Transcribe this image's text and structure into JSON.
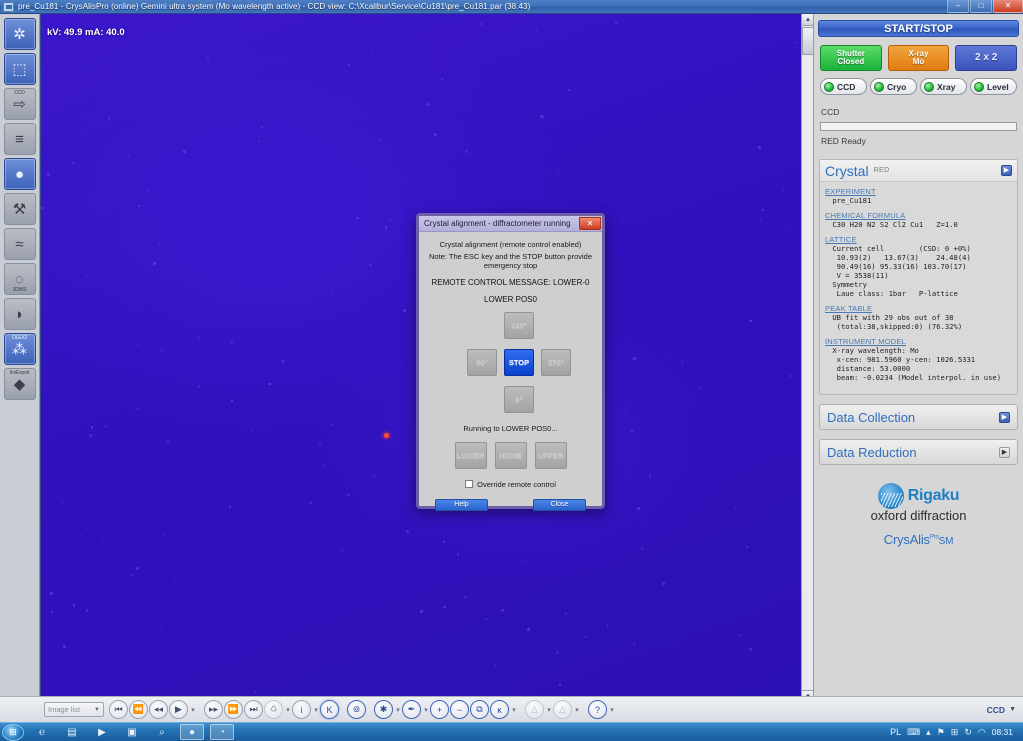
{
  "window": {
    "title": "pre_Cu181 - CrysAlisPro (online) Gemini ultra system (Mo wavelength active) - CCD view: C:\\Xcalibur\\Service\\Cu181\\pre_Cu181.par  (38.43)",
    "minimize_label": "–",
    "maximize_label": "□",
    "close_label": "✕"
  },
  "left_tools": [
    {
      "name": "crystal-screening-tool",
      "glyph": "✲",
      "top_label": "",
      "bottom_label": "",
      "selected": true
    },
    {
      "name": "data-collection-tool",
      "glyph": "⬚",
      "top_label": "",
      "bottom_label": "",
      "selected": true
    },
    {
      "name": "data-reduction-tool",
      "glyph": "⇨",
      "top_label": "CCD",
      "bottom_label": "",
      "selected": false
    },
    {
      "name": "frames-tool",
      "glyph": "≡",
      "top_label": "",
      "bottom_label": "",
      "selected": false
    },
    {
      "name": "ccd-view-tool",
      "glyph": "●",
      "top_label": "",
      "bottom_label": "",
      "selected": true
    },
    {
      "name": "instrument-tool",
      "glyph": "⚒",
      "top_label": "",
      "bottom_label": "",
      "selected": false
    },
    {
      "name": "diffraction-pattern-tool",
      "glyph": "≈",
      "top_label": "",
      "bottom_label": "",
      "selected": false
    },
    {
      "name": "reciprocal-space-tool",
      "glyph": "◌",
      "top_label": "",
      "bottom_label": "3DWS",
      "selected": false
    },
    {
      "name": "camera-tool",
      "glyph": "◗",
      "top_label": "",
      "bottom_label": "",
      "selected": false
    },
    {
      "name": "olex2-tool",
      "glyph": "⁂",
      "top_label": "OLEX2",
      "bottom_label": "",
      "selected": true
    },
    {
      "name": "import-export-tool",
      "glyph": "◆",
      "top_label": "Im/Export",
      "bottom_label": "",
      "selected": false
    }
  ],
  "image_view": {
    "kv_readout": "kV: 49.9 mA: 40.0",
    "scroll_up": "▲",
    "scroll_down": "▼"
  },
  "right_panel": {
    "start_stop_label": "START/STOP",
    "buttons": [
      {
        "name": "shutter-button",
        "line1": "Shutter",
        "line2": "Closed",
        "color": "#19b23a"
      },
      {
        "name": "xray-button",
        "line1": "X-ray",
        "line2": "Mo",
        "color": "#e07c12"
      },
      {
        "name": "binning-button",
        "line1": "2 x 2",
        "line2": "",
        "color": "#3a53bb"
      }
    ],
    "leds": [
      {
        "name": "ccd-led",
        "label": "CCD"
      },
      {
        "name": "cryo-led",
        "label": "Cryo"
      },
      {
        "name": "xray-led",
        "label": "Xray"
      },
      {
        "name": "level-led",
        "label": "Level"
      }
    ],
    "ccd_label": "CCD",
    "progress_percent": 0,
    "status_text": "RED  Ready",
    "crystal": {
      "title": "Crystal",
      "subtitle": "RED",
      "groups": [
        {
          "title": "EXPERIMENT",
          "lines": [
            " pre_Cu181"
          ]
        },
        {
          "title": "CHEMICAL FORMULA",
          "lines": [
            " C30 H20 N2 S2 Cl2 Cu1   Z=1.0"
          ]
        },
        {
          "title": "LATTICE",
          "lines": [
            " Current cell        (CSD: 0 +0%)",
            "  10.93(2)   13.67(3)    24.48(4)",
            "  90.49(16) 95.33(16) 103.70(17)",
            "  V = 3538(11)",
            " Symmetry",
            "  Laue class: 1bar   P-lattice"
          ]
        },
        {
          "title": "PEAK TABLE",
          "lines": [
            " UB fit with 29 obs out of 38",
            "  (total:38,skipped:0) (76.32%)"
          ]
        },
        {
          "title": "INSTRUMENT MODEL",
          "lines": [
            " X-ray wavelength: Mo",
            "  x-cen: 981.5960 y-cen: 1026.5331",
            "  distance: 53.0000",
            "  beam: -0.0234 (Model interpol. in use)"
          ]
        }
      ]
    },
    "data_collection_label": "Data Collection",
    "data_reduction_label": "Data Reduction",
    "brand_name": "Rigaku",
    "brand_sub": "oxford diffraction",
    "product_name": "CrysAlis",
    "product_suffix": "SM",
    "product_tm": "Pro"
  },
  "bottom_bar": {
    "image_list_label": "Image list",
    "nav_buttons": [
      {
        "name": "first-image-button",
        "glyph": "⏮"
      },
      {
        "name": "prev-block-button",
        "glyph": "⏪"
      },
      {
        "name": "prev-image-button",
        "glyph": "◂◂"
      },
      {
        "name": "play-button",
        "glyph": "▶"
      },
      {
        "name": "next-image-button",
        "glyph": "▸▸"
      },
      {
        "name": "next-block-button",
        "glyph": "⏩"
      },
      {
        "name": "last-image-button",
        "glyph": "⏭"
      },
      {
        "name": "loop-button",
        "glyph": "♻"
      },
      {
        "name": "info-button",
        "glyph": "i"
      },
      {
        "name": "k-button",
        "glyph": "K"
      },
      {
        "name": "mask-button",
        "glyph": "⊚"
      },
      {
        "name": "brightness-button",
        "glyph": "✱"
      },
      {
        "name": "pointer-button",
        "glyph": "✒"
      },
      {
        "name": "zoom-in-button",
        "glyph": "+"
      },
      {
        "name": "zoom-out-button",
        "glyph": "−"
      },
      {
        "name": "zoom-fit-button",
        "glyph": "⧉"
      },
      {
        "name": "peak-hunt-button",
        "glyph": "ĸ"
      },
      {
        "name": "up-arrow-button",
        "glyph": "△"
      },
      {
        "name": "up-arrow2-button",
        "glyph": "△"
      },
      {
        "name": "help-button",
        "glyph": "?"
      }
    ],
    "detector_label": "CCD",
    "dropdown_caret": "▼"
  },
  "taskbar": {
    "start_glyph": "⊞",
    "apps": [
      {
        "name": "internet-explorer-taskbar-icon",
        "glyph": "℮",
        "open": false
      },
      {
        "name": "explorer-taskbar-icon",
        "glyph": "▤",
        "open": false
      },
      {
        "name": "media-player-taskbar-icon",
        "glyph": "▶",
        "open": false
      },
      {
        "name": "save-taskbar-icon",
        "glyph": "▣",
        "open": false
      },
      {
        "name": "search-taskbar-icon",
        "glyph": "⌕",
        "open": false
      },
      {
        "name": "crysalispro-taskbar-icon",
        "glyph": "●",
        "open": true
      },
      {
        "name": "secondary-app-taskbar-icon",
        "glyph": "◔",
        "open": true
      }
    ],
    "tray": [
      {
        "name": "tray-language-indicator",
        "glyph": "PL"
      },
      {
        "name": "tray-hardware-icon",
        "glyph": "⌨"
      },
      {
        "name": "tray-overflow-icon",
        "glyph": "▴"
      },
      {
        "name": "tray-flag-icon",
        "glyph": "⚑"
      },
      {
        "name": "tray-network-icon",
        "glyph": "⊞"
      },
      {
        "name": "tray-action-center-icon",
        "glyph": "↻"
      },
      {
        "name": "tray-volume-icon",
        "glyph": "◠"
      }
    ],
    "clock": "08:31"
  },
  "dialog": {
    "title": "Crystal alignment - diffractometer running",
    "close_label": "✕",
    "line1": "Crystal alignment (remote control enabled)",
    "line2": "Note: The ESC key and the STOP button provide emergency stop",
    "line3": "REMOTE CONTROL MESSAGE: LOWER-0",
    "line4": "LOWER  POS0",
    "pad_buttons": [
      {
        "name": "rotate-180-button",
        "label": "180°"
      },
      {
        "name": "rotate-90-button",
        "label": "90°"
      },
      {
        "name": "stop-button",
        "label": "STOP"
      },
      {
        "name": "rotate-270-button",
        "label": "270°"
      },
      {
        "name": "rotate-0-button",
        "label": "0°"
      }
    ],
    "running_text": "Running to LOWER  POS0...",
    "position_buttons": [
      {
        "name": "lower-button",
        "label": "LOWER"
      },
      {
        "name": "home-button",
        "label": "HOME"
      },
      {
        "name": "upper-button",
        "label": "UPPER"
      }
    ],
    "override_label": "Override remote control",
    "override_checked": false,
    "help_label": "Help",
    "close_button_label": "Close"
  }
}
